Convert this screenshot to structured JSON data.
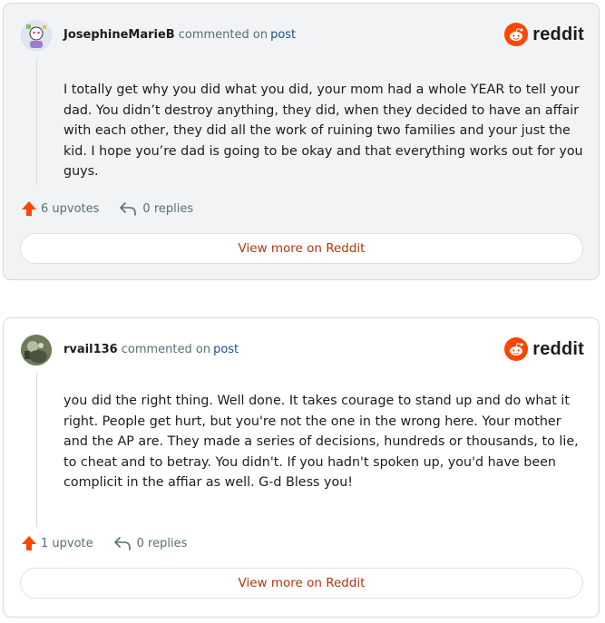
{
  "brand": {
    "name": "reddit",
    "accent_color": "#ff4500"
  },
  "comments": [
    {
      "username": "JosephineMarieB",
      "commented_on": "commented on",
      "post_label": "post",
      "body": "I totally get why you did what you did, your mom had a whole YEAR to tell your dad. You didn’t destroy anything, they did, when they decided to have an affair with each other, they did all the work of ruining two families and your just the kid. I hope you’re dad is going to be okay and that everything works out for you guys.",
      "upvotes": "6 upvotes",
      "replies": "0 replies",
      "view_more": "View more on Reddit"
    },
    {
      "username": "rvail136",
      "commented_on": "commented on",
      "post_label": "post",
      "body": "you did the right thing. Well done. It takes courage to stand up and do what it right. People get hurt, but you're not the one in the wrong here. Your mother and the AP are. They made a series of decisions, hundreds or thousands, to lie, to cheat and to betray. You didn't. If you hadn't spoken up, you'd have been complicit in the affiar as well. G-d Bless you!",
      "upvotes": "1 upvote",
      "replies": "0 replies",
      "view_more": "View more on Reddit"
    }
  ],
  "icons": {
    "upvote": "upvote-arrow-icon",
    "reply": "reply-arrow-icon",
    "logo": "reddit-snoo-icon"
  }
}
